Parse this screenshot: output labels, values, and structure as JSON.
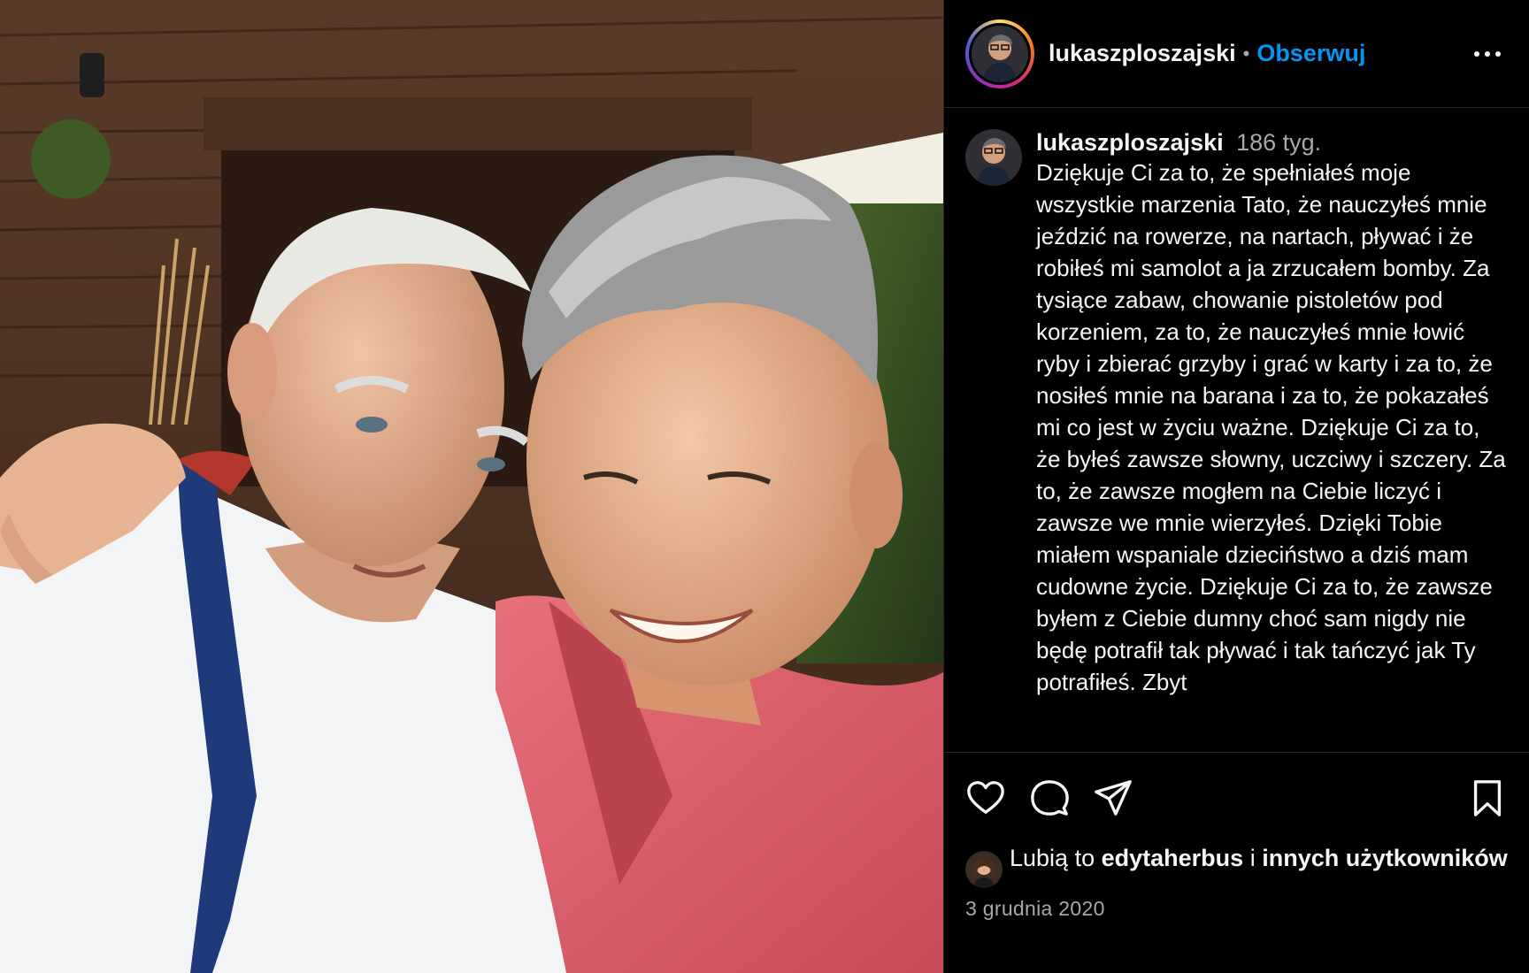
{
  "header": {
    "username": "lukaszploszajski",
    "separator": "•",
    "follow_label": "Obserwuj"
  },
  "caption": {
    "username": "lukaszploszajski",
    "time": "186 tyg.",
    "text": "Dziękuje Ci za to, że spełniałeś moje wszystkie marzenia Tato, że nauczyłeś mnie jeździć na rowerze, na nartach, pływać i że robiłeś mi samolot a ja zrzucałem bomby. Za tysiące zabaw, chowanie pistoletów pod korzeniem, za to, że nauczyłeś mnie łowić ryby i zbierać grzyby i grać w karty i za to, że nosiłeś mnie na barana i za to, że pokazałeś mi co jest w życiu ważne. Dziękuje Ci za to, że byłeś zawsze słowny, uczciwy i szczery. Za to, że zawsze mogłem na Ciebie liczyć i zawsze we mnie wierzyłeś. Dzięki Tobie miałem wspaniale dzieciństwo a dziś mam cudowne życie. Dziękuje Ci za to, że zawsze byłem z Ciebie dumny choć sam nigdy nie będę potrafił tak pływać i tak tańczyć jak Ty potrafiłeś. Zbyt"
  },
  "likes": {
    "prefix": "Lubią to",
    "user": "edytaherbus",
    "connector": "i",
    "others": "innych użytkowników"
  },
  "date": "3 grudnia 2020",
  "icons": {
    "like": "heart-icon",
    "comment": "comment-icon",
    "share": "share-icon",
    "save": "bookmark-icon",
    "more": "more-icon"
  },
  "colors": {
    "accent": "#0095f6",
    "muted": "#a8a8a8",
    "background": "#000000"
  }
}
